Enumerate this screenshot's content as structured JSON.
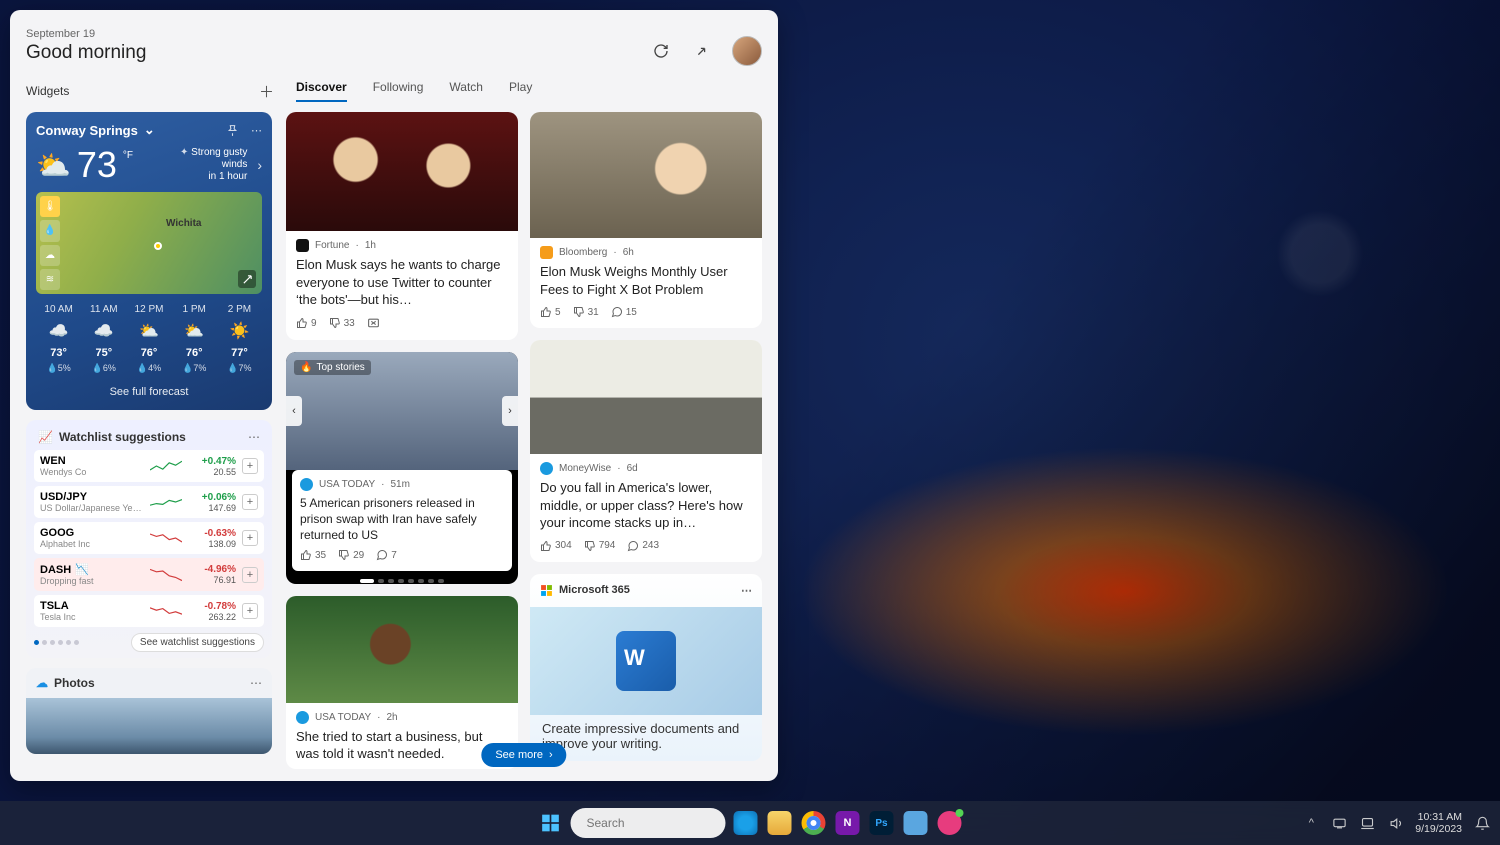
{
  "header": {
    "date": "September 19",
    "greeting": "Good morning"
  },
  "widgets_label": "Widgets",
  "tabs": [
    "Discover",
    "Following",
    "Watch",
    "Play"
  ],
  "active_tab": 0,
  "weather": {
    "location": "Conway Springs",
    "temp": "73",
    "unit": "°F",
    "condition_line1": "Strong gusty winds",
    "condition_line2": "in 1 hour",
    "map_city": "Wichita",
    "hourly": [
      {
        "time": "10 AM",
        "icon": "☁️",
        "temp": "73°",
        "precip": "5%"
      },
      {
        "time": "11 AM",
        "icon": "☁️",
        "temp": "75°",
        "precip": "6%"
      },
      {
        "time": "12 PM",
        "icon": "⛅",
        "temp": "76°",
        "precip": "4%"
      },
      {
        "time": "1 PM",
        "icon": "⛅",
        "temp": "76°",
        "precip": "7%"
      },
      {
        "time": "2 PM",
        "icon": "☀️",
        "temp": "77°",
        "precip": "7%"
      }
    ],
    "see_full": "See full forecast"
  },
  "watchlist": {
    "title": "Watchlist suggestions",
    "stocks": [
      {
        "sym": "WEN",
        "co": "Wendys Co",
        "chg": "+0.47%",
        "val": "20.55",
        "dir": "up"
      },
      {
        "sym": "USD/JPY",
        "co": "US Dollar/Japanese Yen FX …",
        "chg": "+0.06%",
        "val": "147.69",
        "dir": "up"
      },
      {
        "sym": "GOOG",
        "co": "Alphabet Inc",
        "chg": "-0.63%",
        "val": "138.09",
        "dir": "dn"
      },
      {
        "sym": "DASH",
        "co": "Dropping fast",
        "chg": "-4.96%",
        "val": "76.91",
        "dir": "dn",
        "alert": true
      },
      {
        "sym": "TSLA",
        "co": "Tesla Inc",
        "chg": "-0.78%",
        "val": "263.22",
        "dir": "dn"
      }
    ],
    "footer_btn": "See watchlist suggestions"
  },
  "photos": {
    "title": "Photos"
  },
  "feed": {
    "left": [
      {
        "type": "card",
        "img": "img-musk1",
        "src_icon": "#111",
        "source": "Fortune",
        "age": "1h",
        "headline": "Elon Musk says he wants to charge everyone to use Twitter to counter ‘the bots'—but his…",
        "up": "9",
        "down": "33",
        "comments": ""
      },
      {
        "type": "topstories",
        "tag": "Top stories",
        "src_icon": "#1a9adf",
        "source": "USA TODAY",
        "age": "51m",
        "headline": "5 American prisoners released in prison swap with Iran have safely returned to US",
        "up": "35",
        "down": "29",
        "comments": "7"
      },
      {
        "type": "card",
        "img": "img-woman",
        "src_icon": "#1a9adf",
        "source": "USA TODAY",
        "age": "2h",
        "headline": "She tried to start a business, but was told it wasn't needed."
      }
    ],
    "right": [
      {
        "type": "card",
        "img": "img-musk2",
        "src_icon": "#f59c1a",
        "source": "Bloomberg",
        "age": "6h",
        "headline": "Elon Musk Weighs Monthly User Fees to Fight X Bot Problem",
        "up": "5",
        "down": "31",
        "comments": "15"
      },
      {
        "type": "card",
        "img": "img-car",
        "src_icon": "#1a9adf",
        "source": "MoneyWise",
        "age": "6d",
        "headline": "Do you fall in America's lower, middle, or upper class? Here's how your income stacks up in…",
        "up": "304",
        "down": "794",
        "comments": "243"
      },
      {
        "type": "m365",
        "title": "Microsoft 365",
        "headline": "Create impressive documents and improve your writing."
      }
    ],
    "see_more": "See more"
  },
  "taskbar": {
    "search_placeholder": "Search",
    "time": "10:31 AM",
    "date": "9/19/2023"
  }
}
